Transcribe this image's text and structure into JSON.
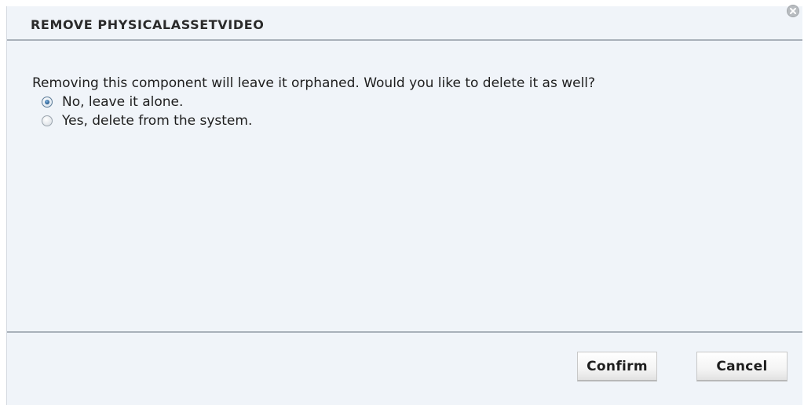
{
  "dialog": {
    "title": "REMOVE PHYSICALASSETVIDEO",
    "close_icon": "close-circle-icon",
    "prompt": "Removing this component will leave it orphaned. Would you like to delete it as well?",
    "options": [
      {
        "label": "No, leave it alone.",
        "selected": true
      },
      {
        "label": "Yes, delete from the system.",
        "selected": false
      }
    ],
    "buttons": {
      "confirm": "Confirm",
      "cancel": "Cancel"
    }
  },
  "colors": {
    "background": "#f0f4f9",
    "divider": "#a9b1ba",
    "radio_selected": "#24598c"
  }
}
